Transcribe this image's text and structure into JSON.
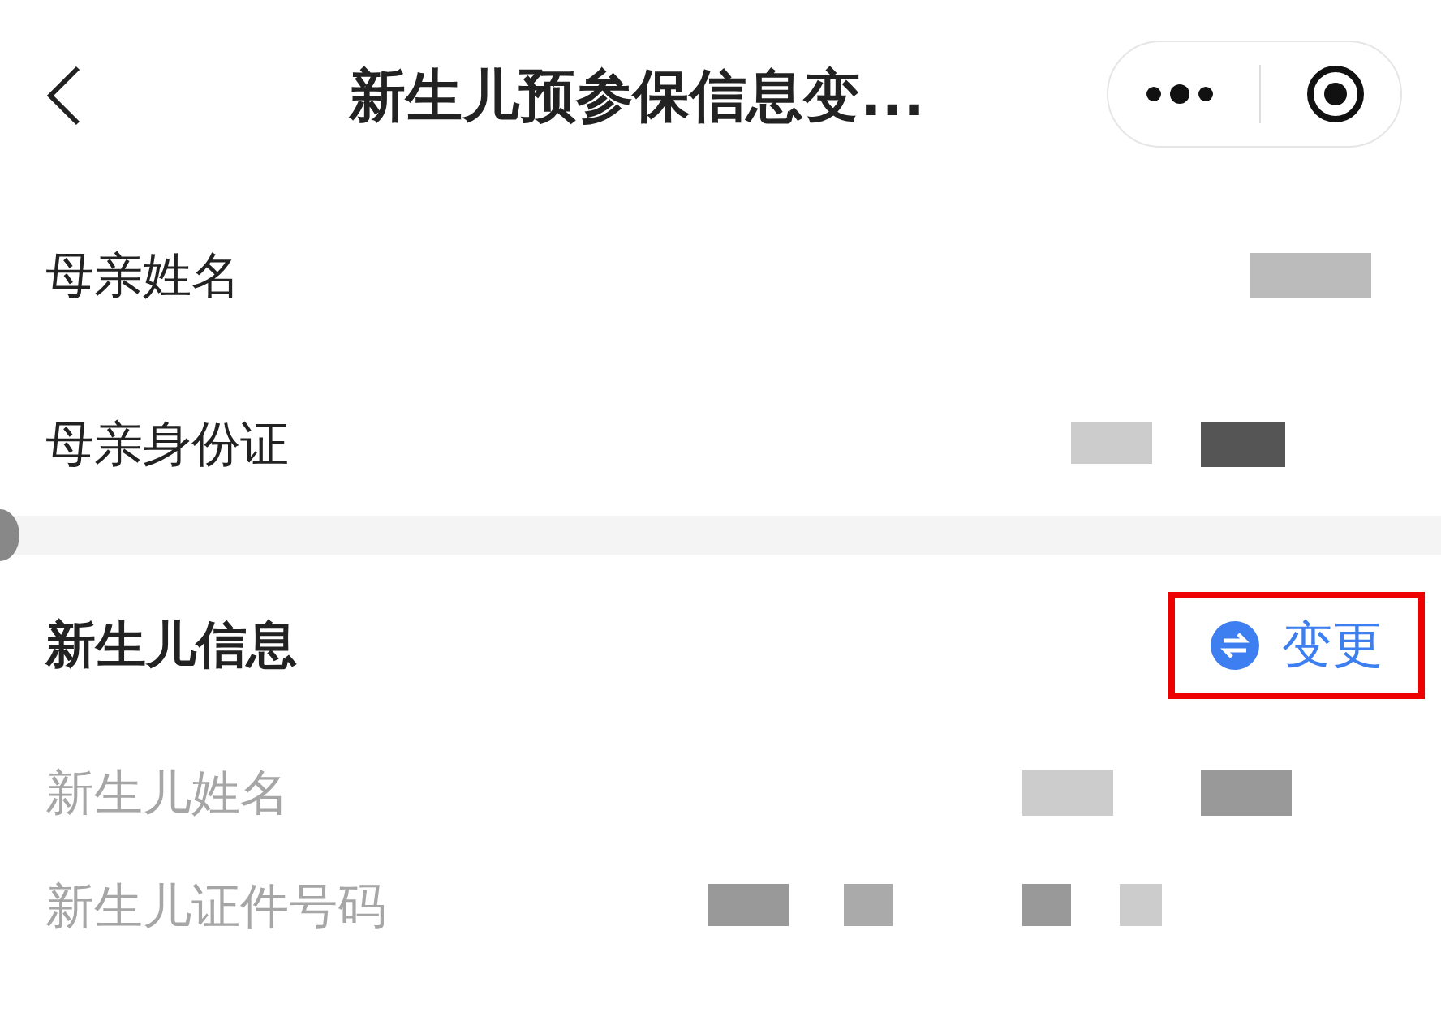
{
  "nav": {
    "title": "新生儿预参保信息变..."
  },
  "mother_rows": [
    {
      "label": "母亲姓名",
      "value_redacted": true
    },
    {
      "label": "母亲身份证",
      "value_redacted": true
    }
  ],
  "newborn_section": {
    "title": "新生儿信息",
    "action": {
      "label": "变更",
      "highlighted": true
    }
  },
  "newborn_rows": [
    {
      "label": "新生儿姓名",
      "value_redacted": true
    },
    {
      "label": "新生儿证件号码",
      "value_redacted": true
    }
  ]
}
